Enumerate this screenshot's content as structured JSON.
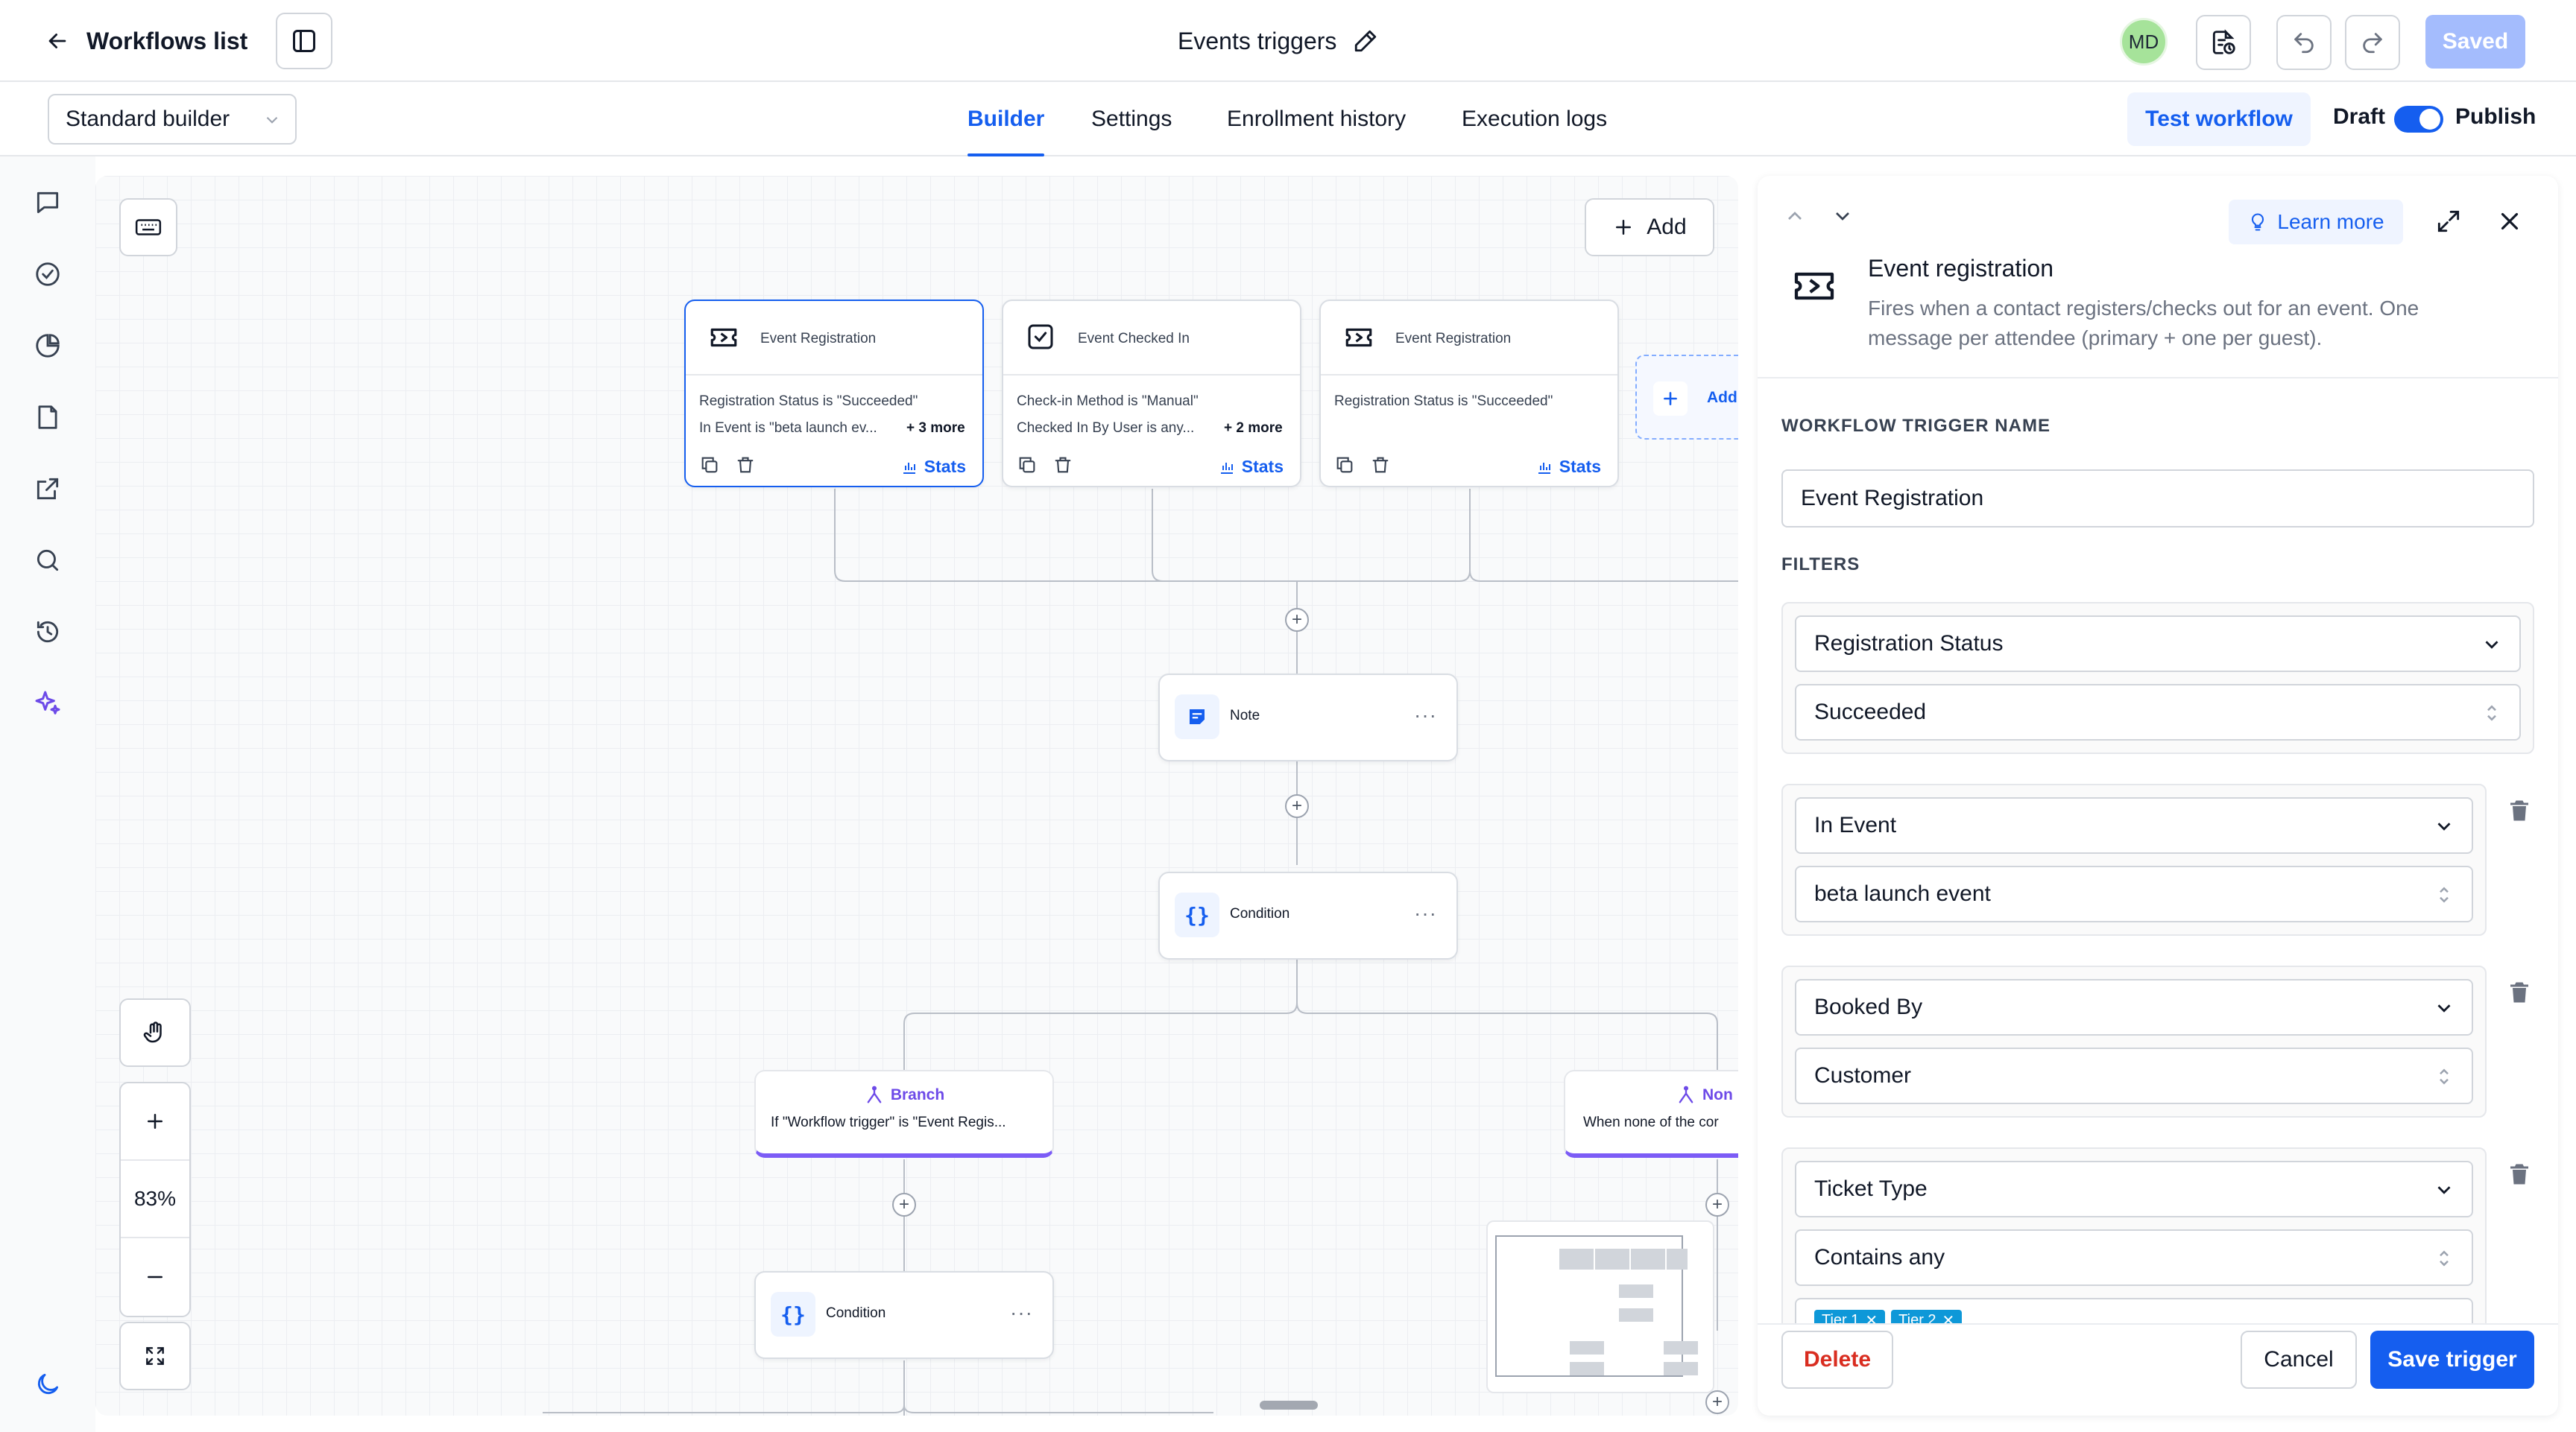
{
  "topbar": {
    "back_label": "Workflows list",
    "workflow_title": "Events triggers",
    "avatar_initials": "MD",
    "saved_label": "Saved"
  },
  "subbar": {
    "builder_select": "Standard builder",
    "tabs": [
      {
        "label": "Builder",
        "active": true
      },
      {
        "label": "Settings",
        "active": false
      },
      {
        "label": "Enrollment history",
        "active": false
      },
      {
        "label": "Execution logs",
        "active": false
      }
    ],
    "test_workflow_label": "Test workflow",
    "draft_label": "Draft",
    "publish_label": "Publish"
  },
  "canvas": {
    "add_label": "Add",
    "triggers": [
      {
        "title": "Event Registration",
        "line1": "Registration Status is \"Succeeded\"",
        "line2": "In Event is \"beta launch ev...",
        "more": "+ 3 more",
        "stats": "Stats",
        "icon": "ticket-icon"
      },
      {
        "title": "Event Checked In",
        "line1": "Check-in Method is \"Manual\"",
        "line2": "Checked In By User is any...",
        "more": "+ 2 more",
        "stats": "Stats",
        "icon": "check-square-icon"
      },
      {
        "title": "Event Registration",
        "line1": "Registration Status is \"Succeeded\"",
        "line2": "",
        "more": "",
        "stats": "Stats",
        "icon": "ticket-icon"
      }
    ],
    "add_trigger_label": "Add",
    "note_label": "Note",
    "condition_label": "Condition",
    "branch_title": "Branch",
    "branch_text": "If \"Workflow trigger\" is \"Event Regis...",
    "none_title": "Non",
    "none_text": "When none of the cor",
    "condition2_label": "Condition",
    "zoom_level": "83%"
  },
  "panel": {
    "learn_more_label": "Learn more",
    "trigger_title": "Event registration",
    "trigger_desc": "Fires when a contact registers/checks out for an event. One message per attendee (primary + one per guest).",
    "trigger_name_heading": "WORKFLOW TRIGGER NAME",
    "trigger_name_value": "Event Registration",
    "filters_heading": "FILTERS",
    "filters": [
      {
        "field": "Registration Status",
        "value": "Succeeded"
      },
      {
        "field": "In Event",
        "value": "beta launch event"
      },
      {
        "field": "Booked By",
        "value": "Customer"
      },
      {
        "field": "Ticket Type",
        "value": "Contains any"
      }
    ],
    "chips": [
      "Tier 1",
      "Tier 2"
    ],
    "delete_label": "Delete",
    "cancel_label": "Cancel",
    "save_label": "Save trigger"
  },
  "colors": {
    "accent": "#155eef",
    "danger": "#d92d20",
    "branch": "#7c5cf6"
  }
}
